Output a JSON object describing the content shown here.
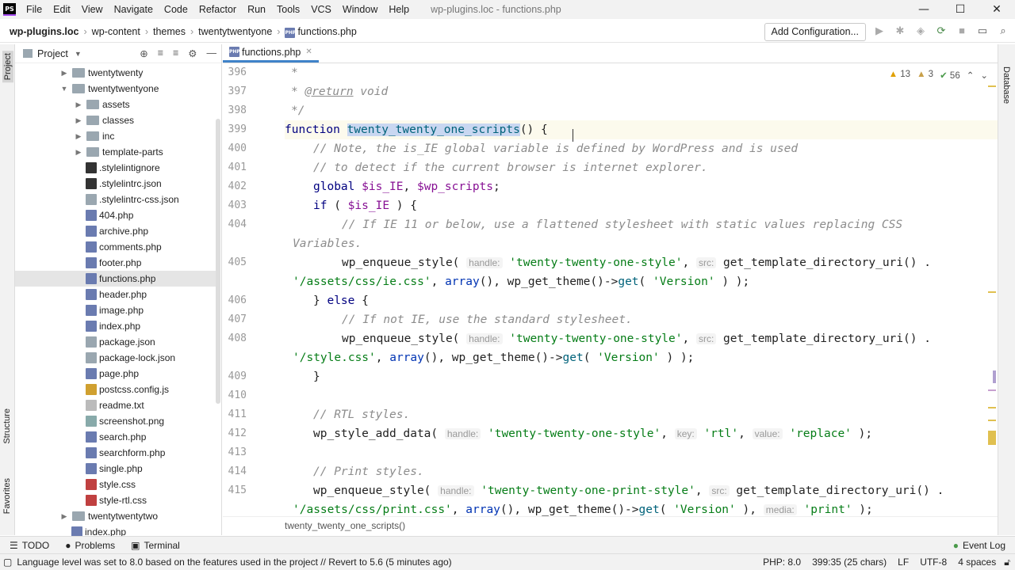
{
  "window": {
    "app_logo": "PS",
    "title": "wp-plugins.loc - functions.php",
    "menu": [
      "File",
      "Edit",
      "View",
      "Navigate",
      "Code",
      "Refactor",
      "Run",
      "Tools",
      "VCS",
      "Window",
      "Help"
    ],
    "controls": [
      "—",
      "☐",
      "✕"
    ]
  },
  "navbar": {
    "breadcrumbs": [
      "wp-plugins.loc",
      "wp-content",
      "themes",
      "twentytwentyone",
      "functions.php"
    ],
    "add_configuration": "Add Configuration..."
  },
  "side_strips": {
    "left_top": "Project",
    "left_mid": "Structure",
    "left_bottom": "Favorites",
    "right_top": "Database"
  },
  "project": {
    "title": "Project",
    "tree": [
      {
        "label": "twentytwenty",
        "type": "folder",
        "depth": 0,
        "expanded": false
      },
      {
        "label": "twentytwentyone",
        "type": "folder",
        "depth": 0,
        "expanded": true
      },
      {
        "label": "assets",
        "type": "folder",
        "depth": 1,
        "expanded": false
      },
      {
        "label": "classes",
        "type": "folder",
        "depth": 1,
        "expanded": false
      },
      {
        "label": "inc",
        "type": "folder",
        "depth": 1,
        "expanded": false
      },
      {
        "label": "template-parts",
        "type": "folder",
        "depth": 1,
        "expanded": false
      },
      {
        "label": ".stylelintignore",
        "type": "lint",
        "depth": 1
      },
      {
        "label": ".stylelintrc.json",
        "type": "lint",
        "depth": 1
      },
      {
        "label": ".stylelintrc-css.json",
        "type": "json",
        "depth": 1
      },
      {
        "label": "404.php",
        "type": "php",
        "depth": 1
      },
      {
        "label": "archive.php",
        "type": "php",
        "depth": 1
      },
      {
        "label": "comments.php",
        "type": "php",
        "depth": 1
      },
      {
        "label": "footer.php",
        "type": "php",
        "depth": 1
      },
      {
        "label": "functions.php",
        "type": "php",
        "depth": 1,
        "selected": true
      },
      {
        "label": "header.php",
        "type": "php",
        "depth": 1
      },
      {
        "label": "image.php",
        "type": "php",
        "depth": 1
      },
      {
        "label": "index.php",
        "type": "php",
        "depth": 1
      },
      {
        "label": "package.json",
        "type": "json",
        "depth": 1
      },
      {
        "label": "package-lock.json",
        "type": "json",
        "depth": 1
      },
      {
        "label": "page.php",
        "type": "php",
        "depth": 1
      },
      {
        "label": "postcss.config.js",
        "type": "js",
        "depth": 1
      },
      {
        "label": "readme.txt",
        "type": "txt",
        "depth": 1
      },
      {
        "label": "screenshot.png",
        "type": "img",
        "depth": 1
      },
      {
        "label": "search.php",
        "type": "php",
        "depth": 1
      },
      {
        "label": "searchform.php",
        "type": "php",
        "depth": 1
      },
      {
        "label": "single.php",
        "type": "php",
        "depth": 1
      },
      {
        "label": "style.css",
        "type": "css",
        "depth": 1
      },
      {
        "label": "style-rtl.css",
        "type": "css",
        "depth": 1
      },
      {
        "label": "twentytwentytwo",
        "type": "folder",
        "depth": 0,
        "expanded": false
      },
      {
        "label": "index.php",
        "type": "php",
        "depth": 0
      }
    ]
  },
  "editor": {
    "tab": "functions.php",
    "inspections": {
      "warnings": "13",
      "weak": "3",
      "ok": "56"
    },
    "footer_breadcrumb": "twenty_twenty_one_scripts()",
    "line_numbers": [
      "396",
      "397",
      "398",
      "399",
      "400",
      "401",
      "402",
      "403",
      "404",
      "",
      "405",
      "",
      "406",
      "407",
      "408",
      "",
      "409",
      "410",
      "411",
      "412",
      "413",
      "414",
      "415",
      ""
    ]
  },
  "bottom_tabs": [
    "TODO",
    "Problems",
    "Terminal"
  ],
  "event_log": "Event Log",
  "status": {
    "message": "Language level was set to 8.0 based on the features used in the project // Revert to 5.6 (5 minutes ago)",
    "php": "PHP: 8.0",
    "position": "399:35 (25 chars)",
    "line_sep": "LF",
    "encoding": "UTF-8",
    "indent": "4 spaces"
  },
  "colors": {
    "accent": "#4083c9",
    "keyword": "#000080",
    "string": "#067d17",
    "comment": "#8c8c8c"
  }
}
